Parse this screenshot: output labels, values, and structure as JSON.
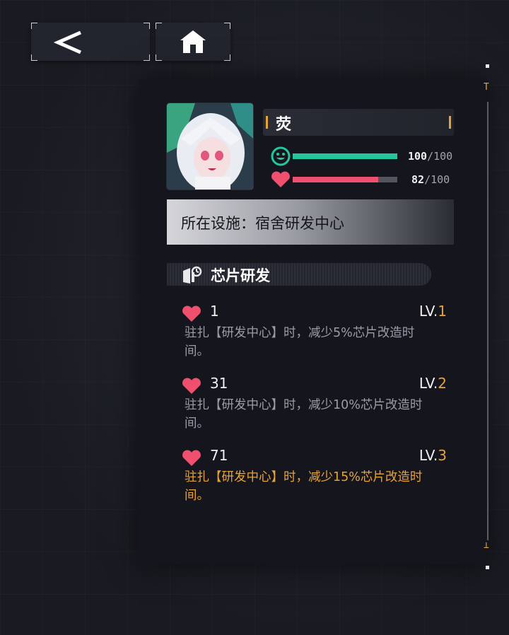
{
  "nav": {
    "back_icon": "chevron-left-icon",
    "home_icon": "home-icon"
  },
  "character": {
    "name": "荧",
    "mood": {
      "current": "100",
      "max": "/100",
      "fraction": 1.0,
      "color": "#22c7a0",
      "icon": "smile-icon"
    },
    "affection": {
      "current": "82",
      "max": "/100",
      "fraction": 0.82,
      "color": "#f0506e",
      "icon": "heart-icon"
    }
  },
  "facility": {
    "label": "所在设施：宿舍研发中心"
  },
  "section": {
    "title": "芯片研发",
    "icon": "chip-research-icon"
  },
  "skills": [
    {
      "req": "1",
      "lv_prefix": "LV.",
      "lv": "1",
      "desc": "驻扎【研发中心】时，减少5%芯片改造时间。",
      "active": false
    },
    {
      "req": "31",
      "lv_prefix": "LV.",
      "lv": "2",
      "desc": "驻扎【研发中心】时，减少10%芯片改造时间。",
      "active": false
    },
    {
      "req": "71",
      "lv_prefix": "LV.",
      "lv": "3",
      "desc": "驻扎【研发中心】时，减少15%芯片改造时间。",
      "active": true
    }
  ],
  "scroll": {
    "top_cap": "T",
    "bottom_cap": "⊥"
  },
  "colors": {
    "accent": "#e8a23a",
    "heart": "#f0506e",
    "mood": "#22c7a0"
  }
}
